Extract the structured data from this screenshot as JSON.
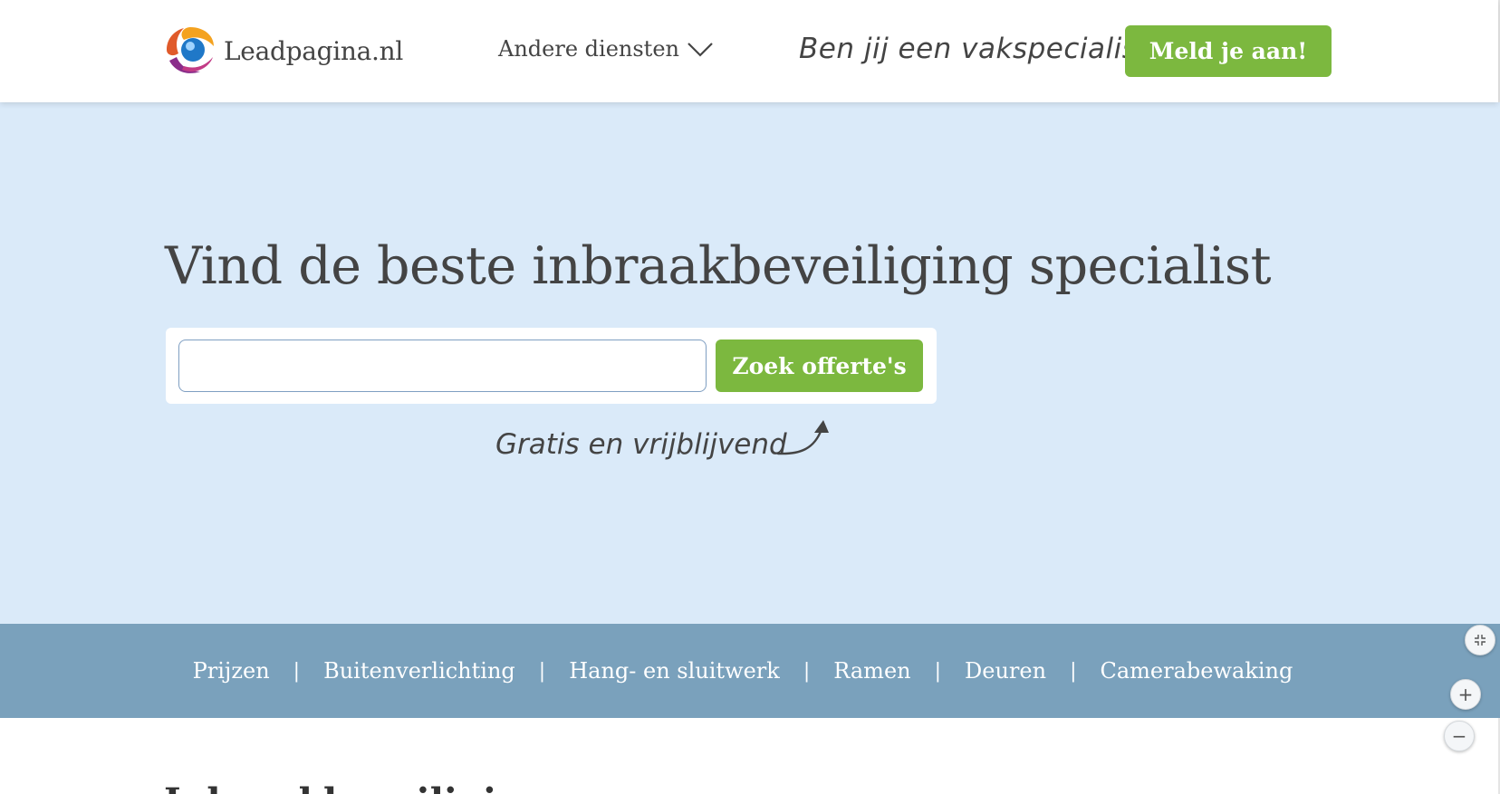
{
  "header": {
    "logo_text": "Leadpagina.nl",
    "other_services": "Andere diensten",
    "pro_question": "Ben jij een vakspecialist?",
    "signup_label": "Meld je aan!"
  },
  "hero": {
    "title": "Vind de beste inbraakbeveiliging specialist",
    "search_value": "",
    "search_button": "Zoek offerte's",
    "free_note": "Gratis en vrijblijvend"
  },
  "subnav": {
    "items": [
      "Prijzen",
      "Buitenverlichting",
      "Hang- en sluitwerk",
      "Ramen",
      "Deuren",
      "Camerabewaking"
    ]
  },
  "content": {
    "heading": "Inbraakbeveiliging"
  },
  "zoom": {
    "plus": "+",
    "minus": "−"
  },
  "colors": {
    "accent_green": "#7cb83f",
    "hero_bg": "#daeaf9",
    "subnav_bg": "#7aa1bc"
  }
}
